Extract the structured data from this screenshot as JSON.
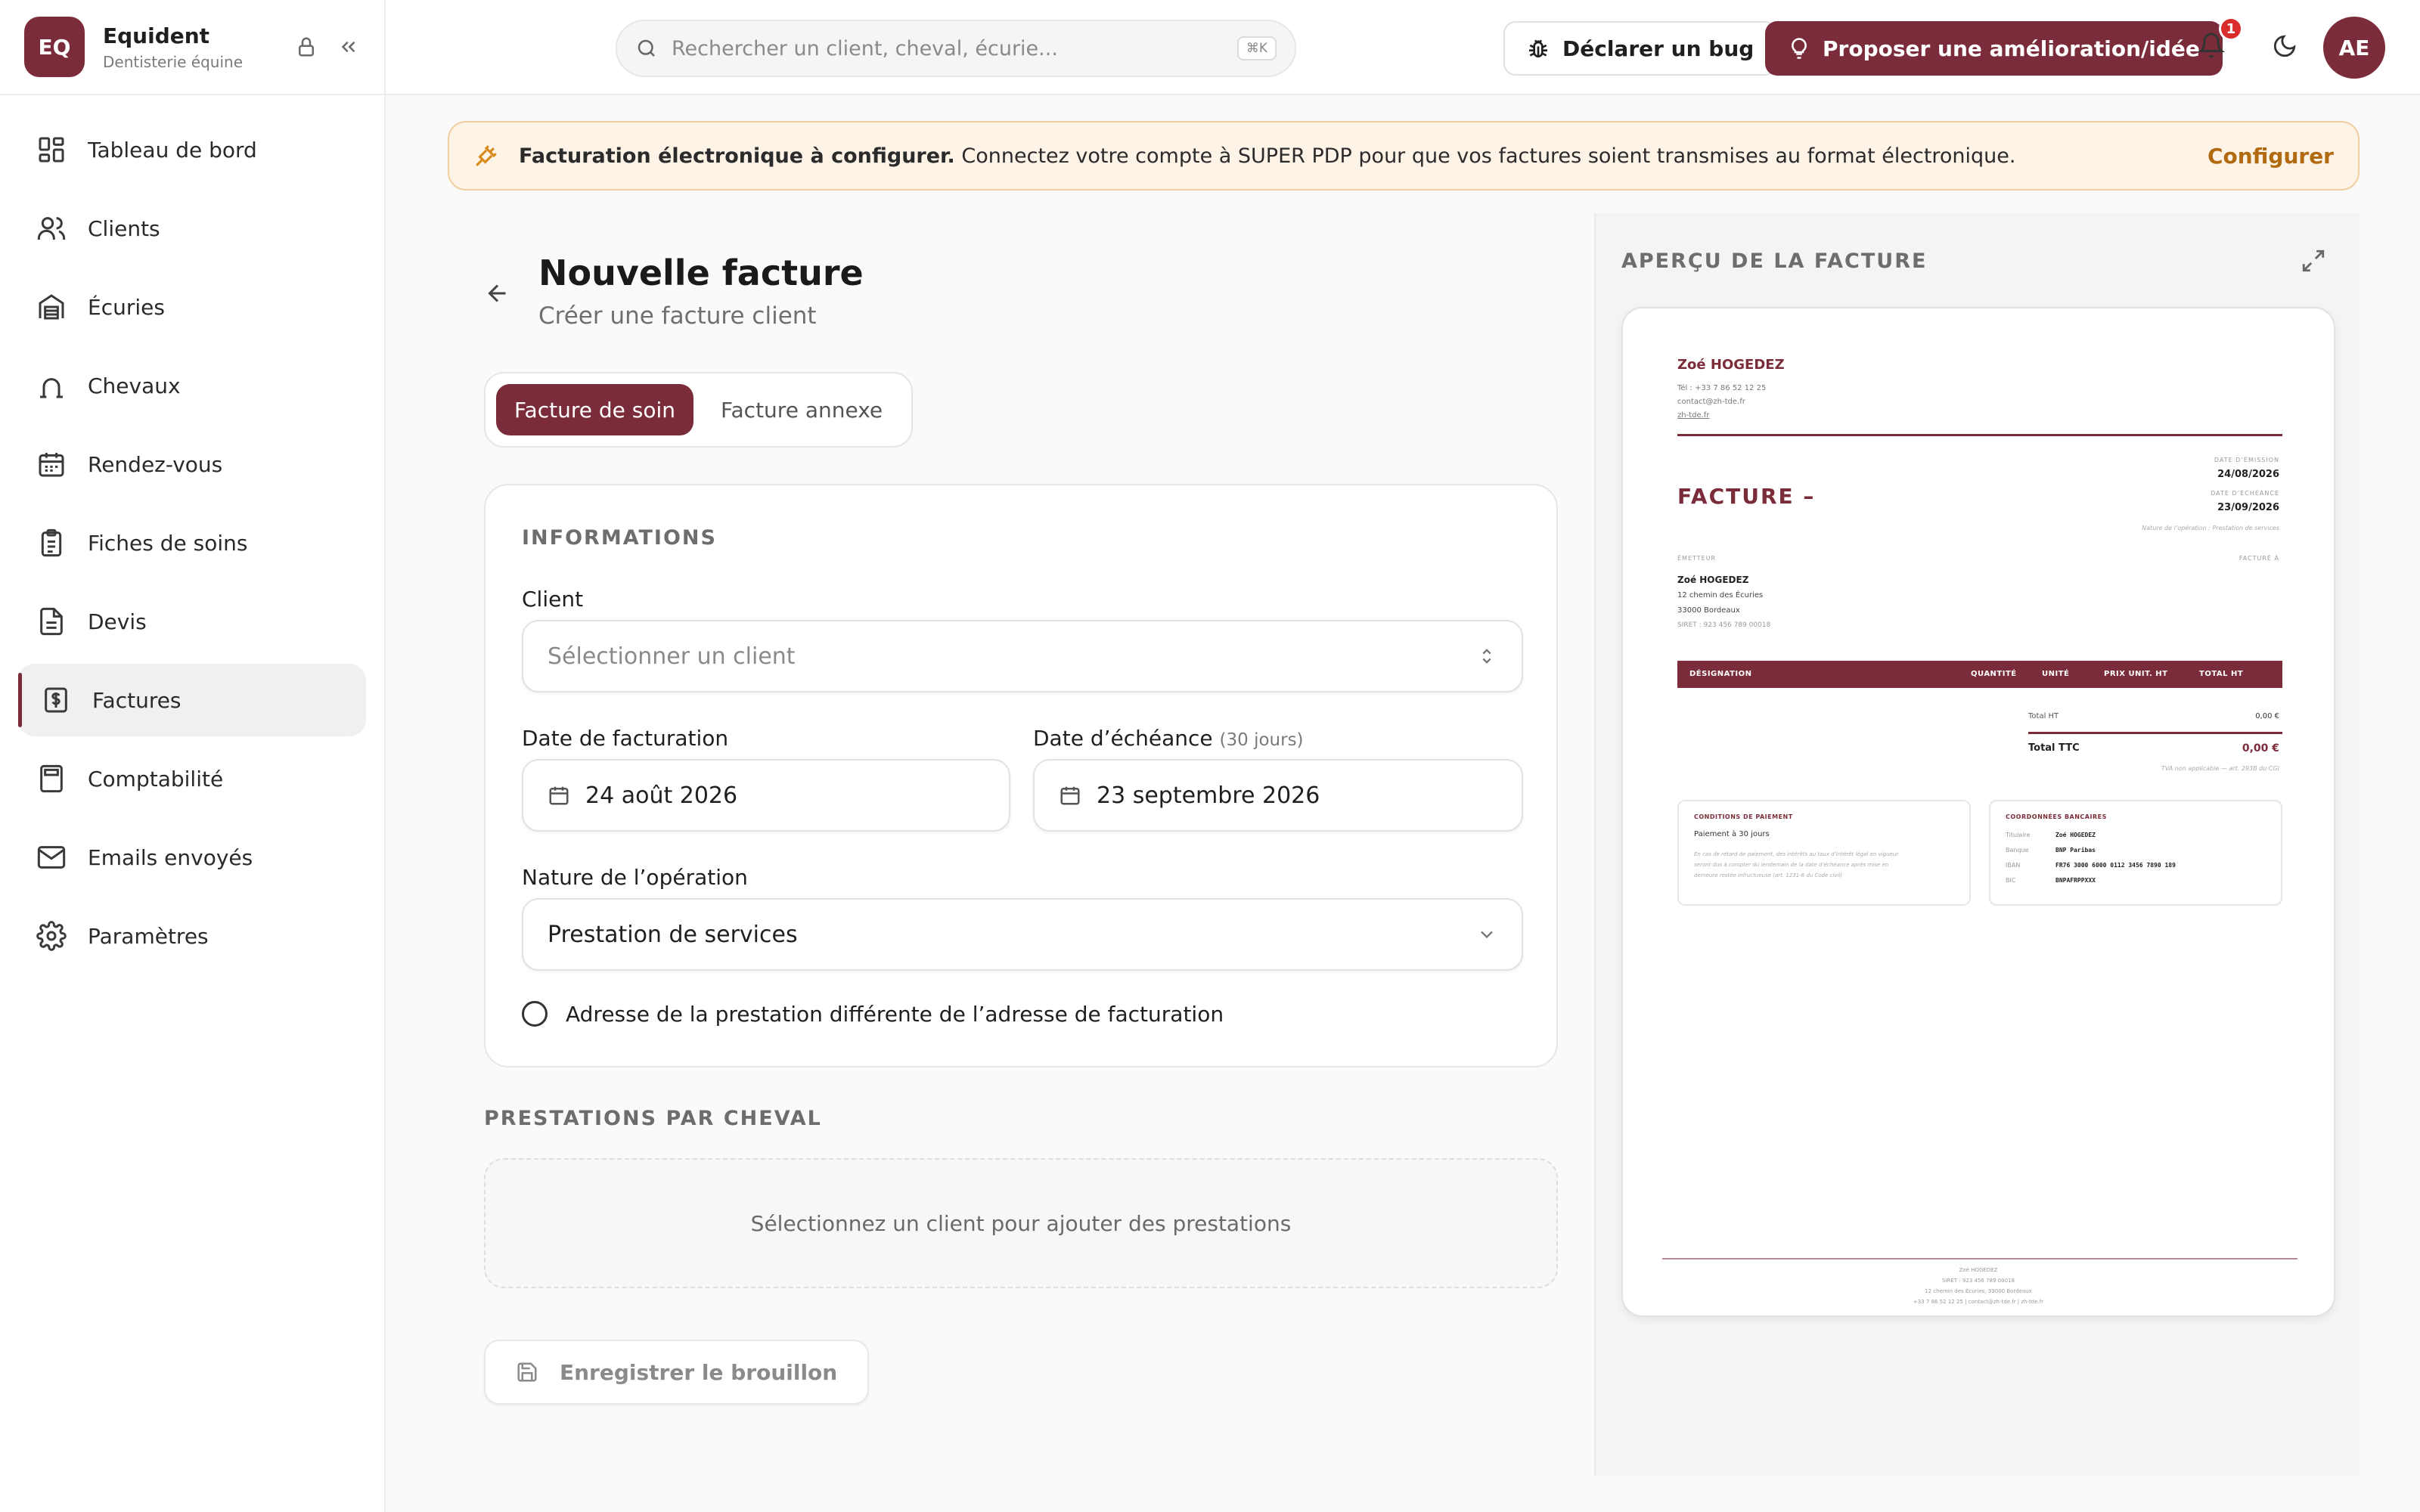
{
  "brand": {
    "initials": "EQ",
    "name": "Equident",
    "subtitle": "Dentisterie équine"
  },
  "sidebar": {
    "items": [
      {
        "label": "Tableau de bord",
        "icon": "dashboard-icon"
      },
      {
        "label": "Clients",
        "icon": "users-icon"
      },
      {
        "label": "Écuries",
        "icon": "stable-icon"
      },
      {
        "label": "Chevaux",
        "icon": "horseshoe-icon"
      },
      {
        "label": "Rendez-vous",
        "icon": "calendar-icon"
      },
      {
        "label": "Fiches de soins",
        "icon": "clipboard-icon"
      },
      {
        "label": "Devis",
        "icon": "document-icon"
      },
      {
        "label": "Factures",
        "icon": "invoice-icon",
        "active": true
      },
      {
        "label": "Comptabilité",
        "icon": "calculator-icon"
      },
      {
        "label": "Emails envoyés",
        "icon": "mail-icon"
      },
      {
        "label": "Paramètres",
        "icon": "gear-icon"
      }
    ]
  },
  "topbar": {
    "search_placeholder": "Rechercher un client, cheval, écurie...",
    "search_shortcut": "⌘K",
    "bug_label": "Déclarer un bug",
    "idea_label": "Proposer une amélioration/idée",
    "notif_count": "1",
    "user_initials": "AE"
  },
  "banner": {
    "title": "Facturation électronique à configurer.",
    "message": "Connectez votre compte à SUPER PDP pour que vos factures soient transmises au format électronique.",
    "action": "Configurer"
  },
  "page": {
    "title": "Nouvelle facture",
    "subtitle": "Créer une facture client",
    "tabs": [
      "Facture de soin",
      "Facture annexe"
    ],
    "active_tab": "Facture de soin"
  },
  "form": {
    "section_title": "INFORMATIONS",
    "client_label": "Client",
    "client_placeholder": "Sélectionner un client",
    "invoice_date_label": "Date de facturation",
    "invoice_date_value": "24 août 2026",
    "due_date_label": "Date d’échéance",
    "due_date_hint": "(30 jours)",
    "due_date_value": "23 septembre 2026",
    "nature_label": "Nature de l’opération",
    "nature_value": "Prestation de services",
    "address_toggle_label": "Adresse de la prestation différente de l’adresse de facturation"
  },
  "prestations": {
    "section_title": "PRESTATIONS PAR CHEVAL",
    "empty_message": "Sélectionnez un client pour ajouter des prestations"
  },
  "actions": {
    "save_draft": "Enregistrer le brouillon"
  },
  "preview": {
    "title": "APERÇU DE LA FACTURE",
    "doc": {
      "issuer_name": "Zoé HOGEDEZ",
      "issuer_phone": "Tél : +33 7 86 52 12 25",
      "issuer_email": "contact@zh-tde.fr",
      "issuer_site": "zh-tde.fr",
      "heading": "FACTURE",
      "heading_suffix": "–",
      "issue_date_label": "DATE D’ÉMISSION",
      "issue_date": "24/08/2026",
      "due_date_label": "DATE D’ÉCHÉANCE",
      "due_date": "23/09/2026",
      "nature_line": "Nature de l’opération : Prestation de services",
      "emitter_label": "ÉMETTEUR",
      "billed_to_label": "FACTURÉ À",
      "emitter_name": "Zoé HOGEDEZ",
      "emitter_street": "12 chemin des Écuries",
      "emitter_city": "33000 Bordeaux",
      "emitter_siret": "SIRET : 923 456 789 00018",
      "col_designation": "DÉSIGNATION",
      "col_quantity": "QUANTITÉ",
      "col_unit": "UNITÉ",
      "col_unit_price": "PRIX UNIT. HT",
      "col_total": "TOTAL HT",
      "total_ht_label": "Total HT",
      "total_ht": "0,00 €",
      "total_ttc_label": "Total TTC",
      "total_ttc": "0,00 €",
      "vat_note": "TVA non applicable — art. 293B du CGI",
      "payment_title": "CONDITIONS DE PAIEMENT",
      "payment_terms": "Paiement à 30 jours",
      "payment_note_1": "En cas de retard de paiement, des intérêts au taux d’intérêt légal en vigueur",
      "payment_note_2": "seront dus à compter du lendemain de la date d’échéance après mise en",
      "payment_note_3": "demeure restée infructueuse (art. 1231-6 du Code civil)",
      "bank_title": "COORDONNÉES BANCAIRES",
      "bank_holder_label": "Titulaire",
      "bank_holder": "Zoé HOGEDEZ",
      "bank_name_label": "Banque",
      "bank_name": "BNP Paribas",
      "iban_label": "IBAN",
      "iban": "FR76 3000 6000 0112 3456 7890 189",
      "bic_label": "BIC",
      "bic": "BNPAFRPPXXX",
      "footer_1": "Zoé HOGEDEZ",
      "footer_2": "SIRET : 923 456 789 00018",
      "footer_3": "12 chemin des Écuries, 33000 Bordeaux",
      "footer_4": "+33 7 86 52 12 25 | contact@zh-tde.fr | zh-tde.fr"
    }
  },
  "colors": {
    "brand": "#7b2c3a",
    "banner_bg": "#fdf3e6",
    "banner_accent": "#b26a10",
    "badge": "#d92d2d"
  }
}
